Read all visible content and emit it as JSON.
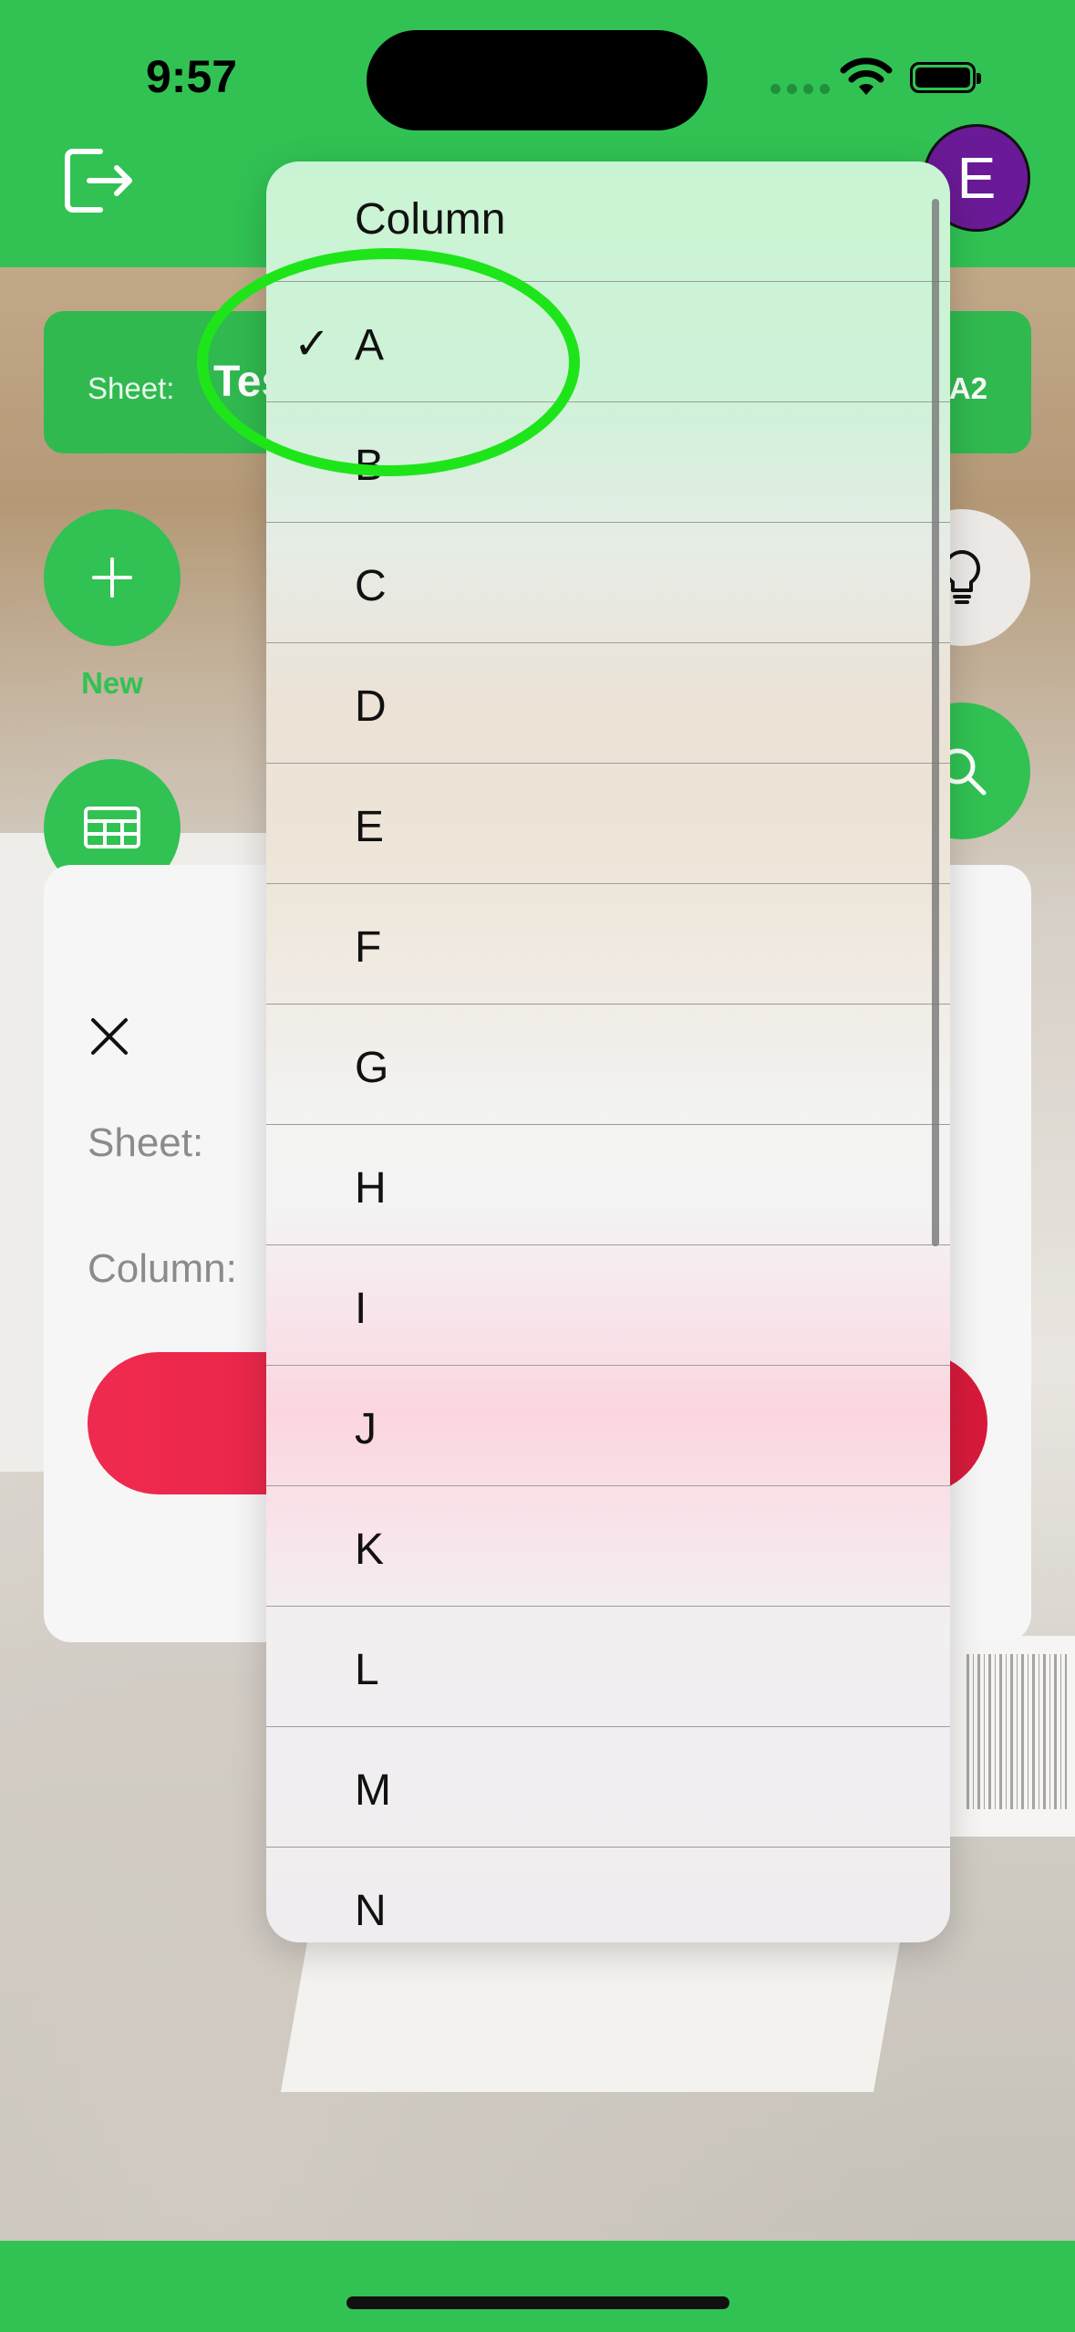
{
  "status_bar": {
    "time": "9:57"
  },
  "nav": {
    "avatar_initial": "E"
  },
  "sheet_bar": {
    "label": "Sheet:",
    "name": "Tes",
    "range": "A2"
  },
  "actions": {
    "new_label": "New"
  },
  "modal": {
    "sheet_label": "Sheet:",
    "column_label": "Column:"
  },
  "menu": {
    "header": "Column",
    "selected": "A",
    "items": [
      "A",
      "B",
      "C",
      "D",
      "E",
      "F",
      "G",
      "H",
      "I",
      "J",
      "K",
      "L",
      "M",
      "N"
    ]
  },
  "colors": {
    "brand_green": "#31c253",
    "avatar_purple": "#6a1a96",
    "action_red": "#e5244a",
    "annotation_green": "#1ee51a"
  }
}
